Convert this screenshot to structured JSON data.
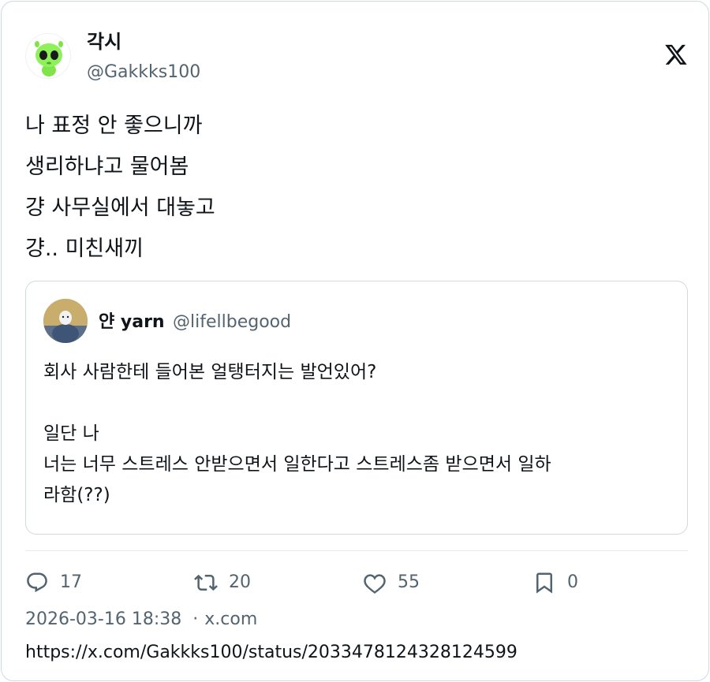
{
  "author": {
    "name": "각시",
    "handle": "@Gakkks100",
    "avatar_icon": "green-alien-avatar"
  },
  "brand_icon": "x-logo-icon",
  "tweet": {
    "lines": [
      "나 표정 안 좋으니까",
      "생리하냐고 물어봄",
      "걍 사무실에서 대놓고",
      "걍.. 미친새끼"
    ]
  },
  "quoted": {
    "name": "얀 yarn",
    "handle": "@lifellbegood",
    "avatar_icon": "person-photo-avatar",
    "lines": [
      "회사 사람한테 들어본 얼탱터지는 발언있어?",
      "",
      "일단 나",
      "너는 너무 스트레스 안받으면서 일한다고 스트레스좀 받으면서 일하",
      "라함(??)"
    ]
  },
  "actions": {
    "reply": {
      "icon": "reply-icon",
      "count": "17"
    },
    "retweet": {
      "icon": "retweet-icon",
      "count": "20"
    },
    "like": {
      "icon": "heart-icon",
      "count": "55"
    },
    "bookmark": {
      "icon": "bookmark-icon",
      "count": "0"
    }
  },
  "meta": {
    "timestamp": "2026-03-16 18:38",
    "separator": "·",
    "source": "x.com"
  },
  "url": "https://x.com/Gakkks100/status/2033478124328124599",
  "colors": {
    "text": "#0f1419",
    "secondary": "#536471",
    "border": "#cfd9de",
    "alien_green": "#7ee44a"
  }
}
